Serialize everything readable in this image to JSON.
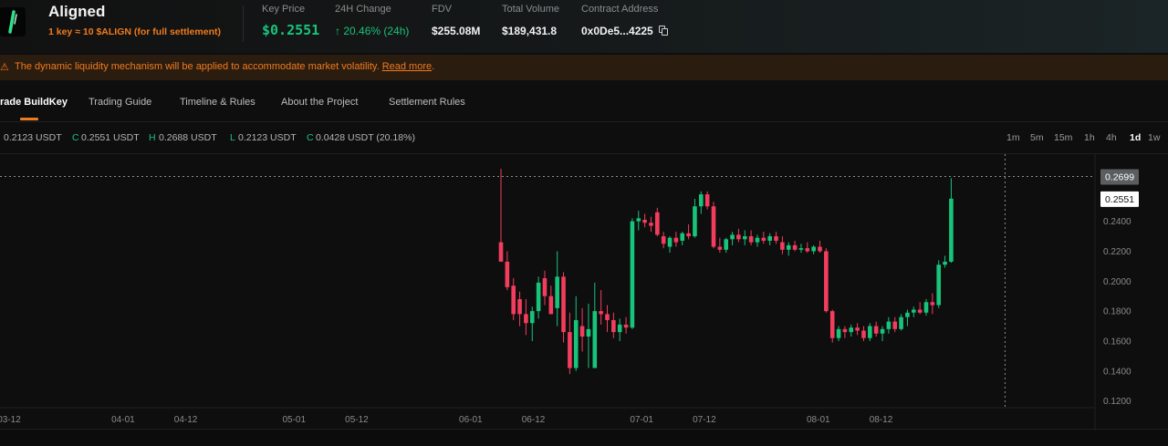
{
  "header": {
    "name": "Aligned",
    "subtitle": "1 key ≈ 10 $ALIGN (for full settlement)",
    "stats": {
      "key_price_label": "Key Price",
      "key_price": "$0.2551",
      "change_label": "24H Change",
      "change": "↑ 20.46% (24h)",
      "fdv_label": "FDV",
      "fdv": "$255.08M",
      "volume_label": "Total Volume",
      "volume": "$189,431.8",
      "contract_label": "Contract Address",
      "contract": "0x0De5...4225"
    }
  },
  "banner": {
    "text": "The dynamic liquidity mechanism will be applied to accommodate market volatility.",
    "link": "Read more",
    "dot": "."
  },
  "tabs": [
    "rade BuildKey",
    "Trading Guide",
    "Timeline & Rules",
    "About the Project",
    "Settlement Rules"
  ],
  "ohlc": {
    "o": "0.2123 USDT",
    "c_label": "C",
    "c": "0.2551 USDT",
    "h_label": "H",
    "h": "0.2688 USDT",
    "l_label": "L",
    "l": "0.2123 USDT",
    "chg_label": "C",
    "chg": "0.0428 USDT (20.18%)"
  },
  "intervals": [
    "1m",
    "5m",
    "15m",
    "1h",
    "4h",
    "1d",
    "1w"
  ],
  "active_interval": "1d",
  "colors": {
    "up": "#18c37a",
    "down": "#f23d5c",
    "accent": "#f07b1d"
  },
  "chart_data": {
    "type": "candlestick",
    "y_ticks": [
      "0.2400",
      "0.2200",
      "0.2000",
      "0.1800",
      "0.1600",
      "0.1400",
      "0.1200"
    ],
    "y_tick_values": [
      0.24,
      0.22,
      0.2,
      0.18,
      0.16,
      0.14,
      0.12
    ],
    "x_ticks": [
      "03-12",
      "04-01",
      "04-12",
      "05-01",
      "05-12",
      "06-01",
      "06-12",
      "07-01",
      "07-12",
      "08-01",
      "08-12"
    ],
    "x_tick_days": [
      0,
      20,
      31,
      50,
      61,
      81,
      92,
      111,
      122,
      142,
      153
    ],
    "ylim": [
      0.1155,
      0.2745
    ],
    "crosshair_label": "0.2699",
    "crosshair_value": 0.2699,
    "last_price_label": "0.2551",
    "last_price": 0.2551,
    "ohlc": [
      [
        0.226,
        0.275,
        0.213,
        0.213
      ],
      [
        0.213,
        0.22,
        0.194,
        0.196
      ],
      [
        0.197,
        0.202,
        0.174,
        0.178
      ],
      [
        0.188,
        0.193,
        0.17,
        0.178
      ],
      [
        0.178,
        0.188,
        0.164,
        0.172
      ],
      [
        0.172,
        0.183,
        0.16,
        0.18
      ],
      [
        0.18,
        0.203,
        0.175,
        0.199
      ],
      [
        0.202,
        0.207,
        0.184,
        0.19
      ],
      [
        0.19,
        0.197,
        0.178,
        0.178
      ],
      [
        0.182,
        0.22,
        0.17,
        0.203
      ],
      [
        0.203,
        0.206,
        0.159,
        0.166
      ],
      [
        0.166,
        0.179,
        0.138,
        0.142
      ],
      [
        0.142,
        0.19,
        0.14,
        0.174
      ],
      [
        0.17,
        0.182,
        0.153,
        0.163
      ],
      [
        0.163,
        0.185,
        0.142,
        0.168
      ],
      [
        0.142,
        0.199,
        0.142,
        0.18
      ],
      [
        0.18,
        0.194,
        0.171,
        0.178
      ],
      [
        0.178,
        0.184,
        0.166,
        0.174
      ],
      [
        0.174,
        0.179,
        0.162,
        0.166
      ],
      [
        0.166,
        0.175,
        0.16,
        0.171
      ],
      [
        0.171,
        0.176,
        0.165,
        0.169
      ],
      [
        0.169,
        0.242,
        0.168,
        0.24
      ],
      [
        0.24,
        0.247,
        0.234,
        0.242
      ],
      [
        0.241,
        0.245,
        0.236,
        0.239
      ],
      [
        0.239,
        0.243,
        0.233,
        0.237
      ],
      [
        0.246,
        0.249,
        0.23,
        0.231
      ],
      [
        0.23,
        0.233,
        0.222,
        0.225
      ],
      [
        0.223,
        0.23,
        0.219,
        0.229
      ],
      [
        0.229,
        0.233,
        0.223,
        0.226
      ],
      [
        0.227,
        0.233,
        0.224,
        0.232
      ],
      [
        0.232,
        0.238,
        0.228,
        0.23
      ],
      [
        0.23,
        0.255,
        0.229,
        0.25
      ],
      [
        0.25,
        0.26,
        0.245,
        0.258
      ],
      [
        0.258,
        0.26,
        0.248,
        0.25
      ],
      [
        0.25,
        0.253,
        0.222,
        0.223
      ],
      [
        0.223,
        0.229,
        0.219,
        0.221
      ],
      [
        0.221,
        0.229,
        0.219,
        0.228
      ],
      [
        0.228,
        0.233,
        0.224,
        0.231
      ],
      [
        0.231,
        0.235,
        0.226,
        0.228
      ],
      [
        0.228,
        0.234,
        0.224,
        0.23
      ],
      [
        0.23,
        0.234,
        0.224,
        0.226
      ],
      [
        0.226,
        0.231,
        0.223,
        0.229
      ],
      [
        0.229,
        0.233,
        0.225,
        0.227
      ],
      [
        0.227,
        0.232,
        0.224,
        0.23
      ],
      [
        0.23,
        0.233,
        0.225,
        0.227
      ],
      [
        0.226,
        0.23,
        0.218,
        0.221
      ],
      [
        0.221,
        0.226,
        0.217,
        0.224
      ],
      [
        0.224,
        0.227,
        0.22,
        0.221
      ],
      [
        0.221,
        0.225,
        0.219,
        0.222
      ],
      [
        0.222,
        0.226,
        0.219,
        0.22
      ],
      [
        0.22,
        0.224,
        0.218,
        0.223
      ],
      [
        0.223,
        0.227,
        0.219,
        0.22
      ],
      [
        0.22,
        0.222,
        0.179,
        0.18
      ],
      [
        0.18,
        0.181,
        0.159,
        0.162
      ],
      [
        0.162,
        0.17,
        0.16,
        0.168
      ],
      [
        0.168,
        0.17,
        0.162,
        0.166
      ],
      [
        0.166,
        0.171,
        0.163,
        0.169
      ],
      [
        0.169,
        0.172,
        0.164,
        0.167
      ],
      [
        0.167,
        0.17,
        0.16,
        0.162
      ],
      [
        0.162,
        0.172,
        0.16,
        0.17
      ],
      [
        0.17,
        0.173,
        0.163,
        0.165
      ],
      [
        0.165,
        0.17,
        0.16,
        0.168
      ],
      [
        0.168,
        0.176,
        0.165,
        0.173
      ],
      [
        0.173,
        0.176,
        0.166,
        0.168
      ],
      [
        0.168,
        0.178,
        0.167,
        0.176
      ],
      [
        0.176,
        0.181,
        0.17,
        0.179
      ],
      [
        0.179,
        0.183,
        0.176,
        0.181
      ],
      [
        0.181,
        0.186,
        0.178,
        0.179
      ],
      [
        0.179,
        0.188,
        0.177,
        0.186
      ],
      [
        0.186,
        0.192,
        0.178,
        0.184
      ],
      [
        0.184,
        0.214,
        0.182,
        0.211
      ],
      [
        0.211,
        0.217,
        0.209,
        0.213
      ],
      [
        0.213,
        0.2688,
        0.2123,
        0.2551
      ]
    ]
  }
}
